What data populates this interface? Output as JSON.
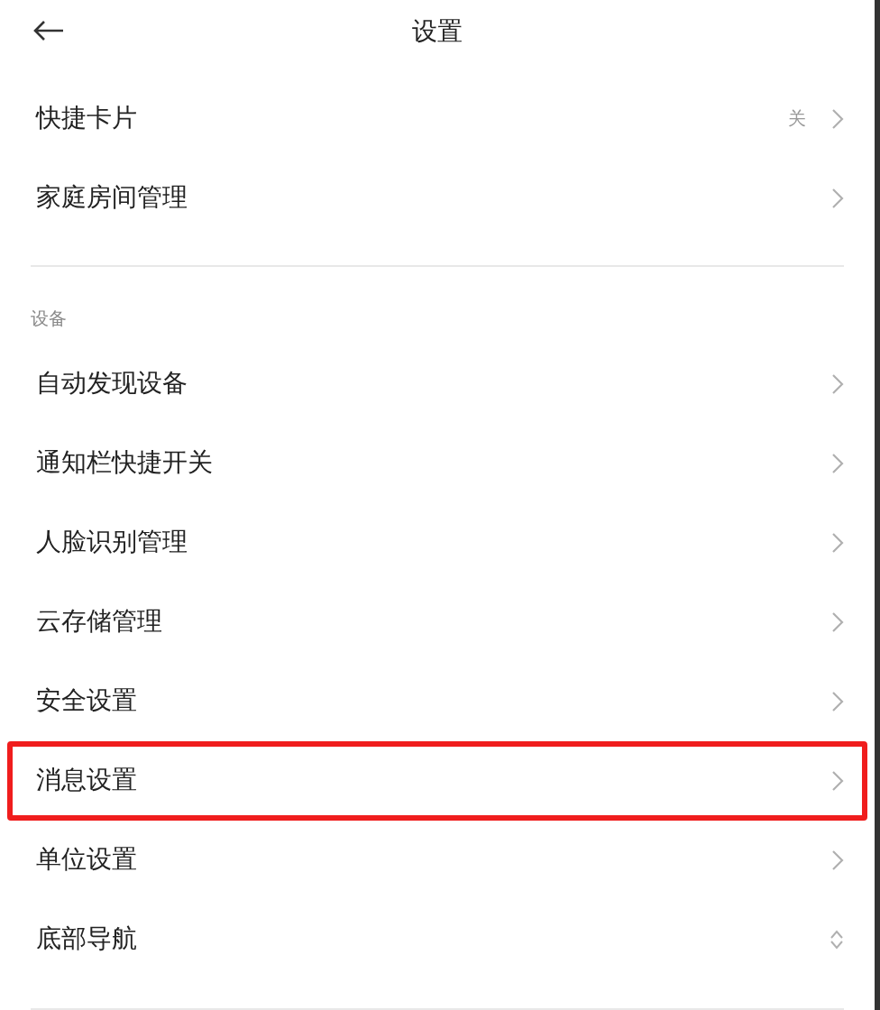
{
  "header": {
    "title": "设置"
  },
  "top_items": [
    {
      "label": "快捷卡片",
      "value": "关",
      "kind": "link",
      "highlighted": false
    },
    {
      "label": "家庭房间管理",
      "kind": "link",
      "highlighted": false
    }
  ],
  "section": {
    "title": "设备",
    "items": [
      {
        "label": "自动发现设备",
        "kind": "link",
        "highlighted": false
      },
      {
        "label": "通知栏快捷开关",
        "kind": "link",
        "highlighted": false
      },
      {
        "label": "人脸识别管理",
        "kind": "link",
        "highlighted": false
      },
      {
        "label": "云存储管理",
        "kind": "link",
        "highlighted": false
      },
      {
        "label": "安全设置",
        "kind": "link",
        "highlighted": false
      },
      {
        "label": "消息设置",
        "kind": "link",
        "highlighted": true
      },
      {
        "label": "单位设置",
        "kind": "link",
        "highlighted": false
      },
      {
        "label": "底部导航",
        "kind": "select",
        "highlighted": false
      }
    ]
  }
}
